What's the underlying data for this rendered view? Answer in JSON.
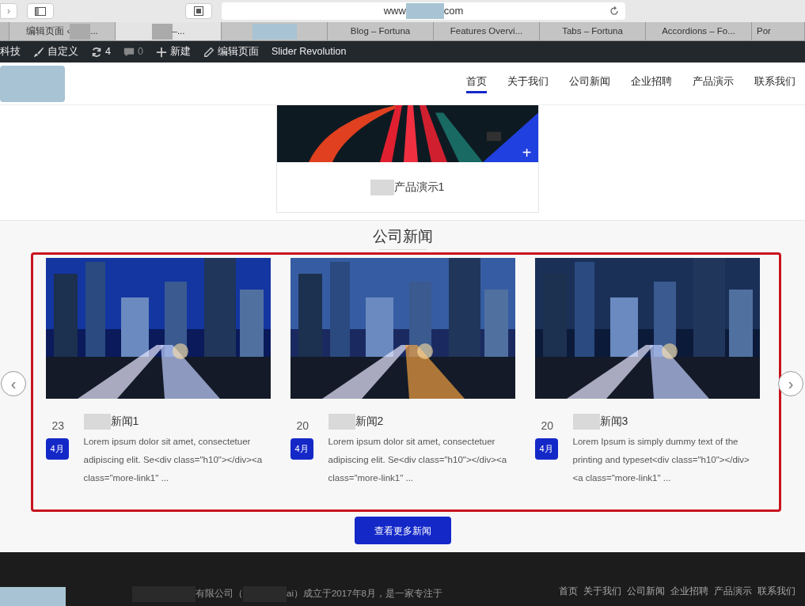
{
  "browser": {
    "url_prefix": "www",
    "url_suffix": "com",
    "tabs": [
      {
        "label": "编辑页面 ‹",
        "suffix": "...",
        "redacted": true,
        "selected": false
      },
      {
        "suffix": "–...",
        "redacted": true,
        "selected": true
      },
      {
        "redacted": true,
        "selected": false
      },
      {
        "label": "Blog – Fortuna",
        "redacted": false,
        "selected": false
      },
      {
        "label": "Features Overvi...",
        "redacted": false,
        "selected": false
      },
      {
        "label": "Tabs – Fortuna",
        "redacted": false,
        "selected": false
      },
      {
        "label": "Accordions – Fo...",
        "redacted": false,
        "selected": false
      },
      {
        "label": "Por",
        "redacted": false,
        "selected": false
      }
    ]
  },
  "admin_bar": [
    {
      "kind": "text",
      "label": "科技"
    },
    {
      "kind": "brush",
      "label": "自定义"
    },
    {
      "kind": "refresh",
      "label": "4"
    },
    {
      "kind": "comment",
      "label": "0"
    },
    {
      "kind": "plus",
      "label": "新建"
    },
    {
      "kind": "pencil",
      "label": "编辑页面"
    },
    {
      "kind": "text",
      "label": "Slider Revolution"
    }
  ],
  "nav": [
    {
      "label": "首页",
      "selected": true
    },
    {
      "label": "关于我们",
      "selected": false
    },
    {
      "label": "公司新闻",
      "selected": false
    },
    {
      "label": "企业招聘",
      "selected": false
    },
    {
      "label": "产品演示",
      "selected": false
    },
    {
      "label": "联系我们",
      "selected": false
    }
  ],
  "product": {
    "title": "产品演示1",
    "plus": "+"
  },
  "news": {
    "heading": "公司新闻",
    "prev": "‹",
    "next": "›",
    "items": [
      {
        "day": "23",
        "month": "4月",
        "title": "新闻1",
        "excerpt": "Lorem ipsum dolor sit amet, consectetuer adipiscing elit. Se<div class=\"h10\"></div><a class=\"more-link1\" ..."
      },
      {
        "day": "20",
        "month": "4月",
        "title": "新闻2",
        "excerpt": "Lorem ipsum dolor sit amet, consectetuer adipiscing elit. Se<div class=\"h10\"></div><a class=\"more-link1\" ..."
      },
      {
        "day": "20",
        "month": "4月",
        "title": "新闻3",
        "excerpt": "Lorem Ipsum is simply dummy text of the printing and typeset<div class=\"h10\"></div><a class=\"more-link1\" ..."
      }
    ],
    "more_button": "查看更多新闻"
  },
  "footer": {
    "text_a": "有限公司（",
    "text_b": "ai）成立于2017年8月，是一家专注于",
    "links": [
      "首页",
      "关于我们",
      "公司新闻",
      "企业招聘",
      "产品演示",
      "联系我们"
    ]
  }
}
